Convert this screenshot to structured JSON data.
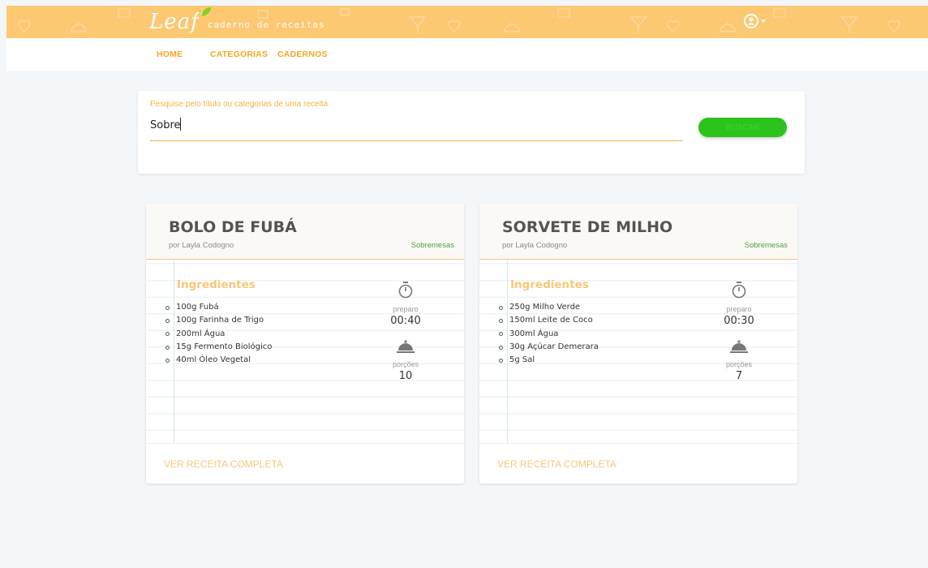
{
  "header": {
    "logo": "Leaf",
    "tagline": "caderno de receitas",
    "bg_color": "#fdc872",
    "user_icon": "user-circle-icon"
  },
  "nav": {
    "items": [
      "HOME",
      "CATEGORIAS",
      "CADERNOS"
    ],
    "color": "#f5a623"
  },
  "search": {
    "label": "Pesquise pelo título ou categorias de uma receita",
    "value": "Sobre",
    "button_label": "BUSCAR",
    "button_color": "#2cc21c"
  },
  "recipes": [
    {
      "title": "BOLO DE FUBÁ",
      "author": "por Layla Codogno",
      "category": "Sobremesas",
      "ingredients_title": "Ingredientes",
      "ingredients": [
        "100g Fubá",
        "100g Farinha de Trigo",
        "200ml Água",
        "15g Fermento Biológico",
        "40ml Óleo Vegetal"
      ],
      "prep_label": "preparo",
      "prep_time": "00:40",
      "portions_label": "porções",
      "portions": "10",
      "link": "VER RECEITA COMPLETA"
    },
    {
      "title": "SORVETE DE MILHO",
      "author": "por Layla Codogno",
      "category": "Sobremesas",
      "ingredients_title": "Ingredientes",
      "ingredients": [
        "250g Milho Verde",
        "150ml Leite de Coco",
        "300ml Água",
        "30g Açúcar Demerara",
        "5g Sal"
      ],
      "prep_label": "preparo",
      "prep_time": "00:30",
      "portions_label": "porções",
      "portions": "7",
      "link": "VER RECEITA COMPLETA"
    }
  ]
}
